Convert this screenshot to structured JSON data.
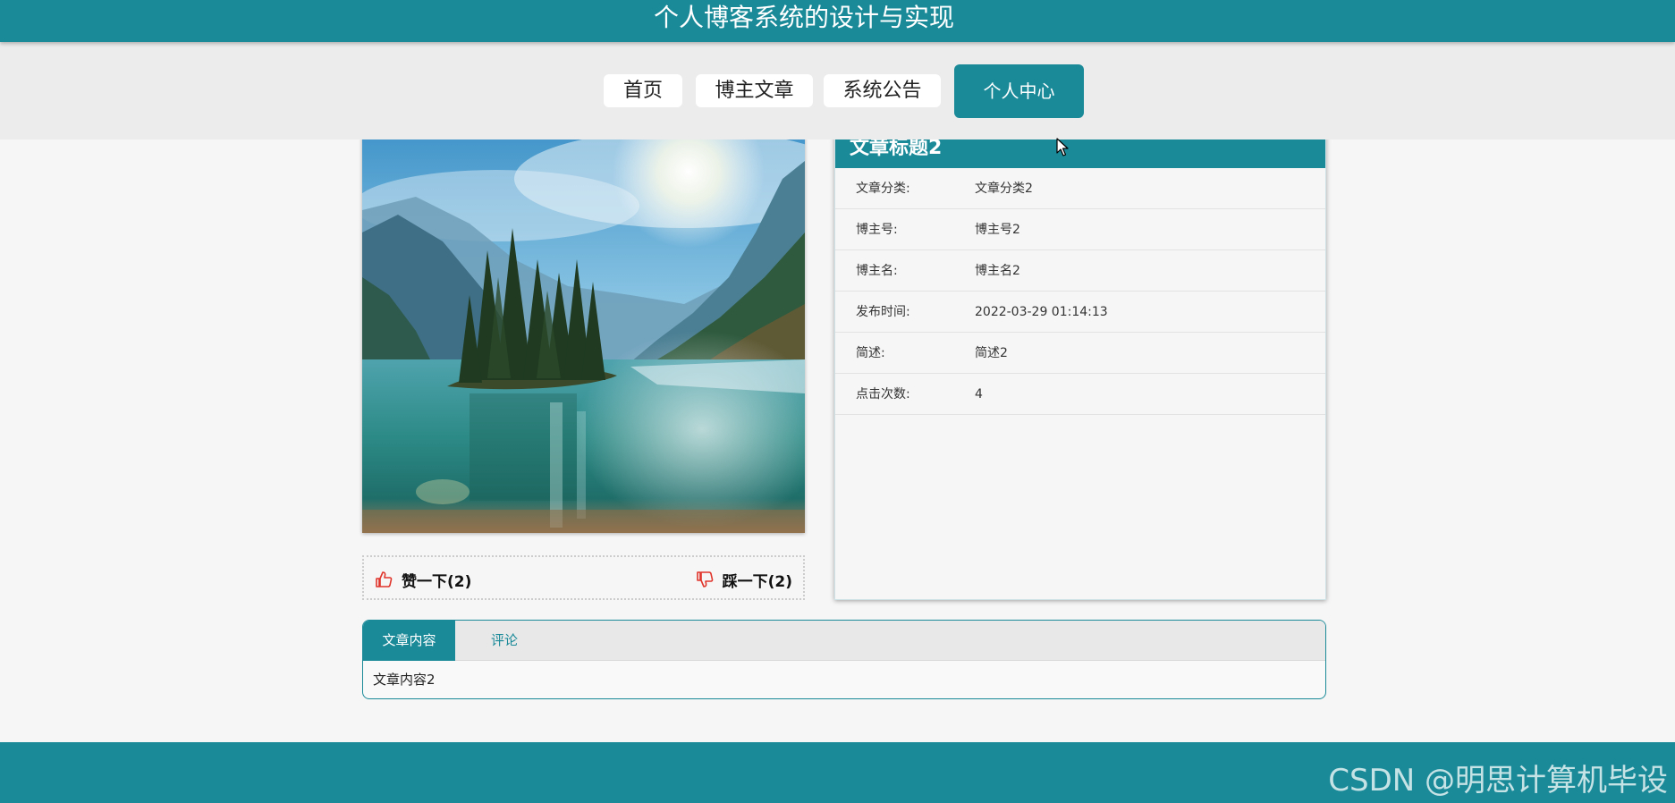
{
  "header": {
    "title": "个人博客系统的设计与实现"
  },
  "nav": {
    "items": [
      {
        "label": "首页"
      },
      {
        "label": "博主文章"
      },
      {
        "label": "系统公告"
      },
      {
        "label": "个人中心"
      }
    ],
    "active_index": 3
  },
  "article": {
    "title": "文章标题2",
    "fields": [
      {
        "label": "文章分类:",
        "value": "文章分类2"
      },
      {
        "label": "博主号:",
        "value": "博主号2"
      },
      {
        "label": "博主名:",
        "value": "博主名2"
      },
      {
        "label": "发布时间:",
        "value": "2022-03-29 01:14:13"
      },
      {
        "label": "简述:",
        "value": "简述2"
      },
      {
        "label": "点击次数:",
        "value": "4"
      }
    ]
  },
  "votes": {
    "like_label": "赞一下(2)",
    "dislike_label": "踩一下(2)"
  },
  "tabs": {
    "items": [
      {
        "label": "文章内容"
      },
      {
        "label": "评论"
      }
    ],
    "content": "文章内容2"
  },
  "footer": {
    "watermark": "CSDN @明思计算机毕设"
  },
  "colors": {
    "primary": "#1a8a99",
    "vote_icon": "#e0352b",
    "page_bg": "#f6f6f6",
    "nav_bg": "#ececec"
  },
  "icons": {
    "like": "thumbs-up-icon",
    "dislike": "thumbs-down-icon"
  }
}
